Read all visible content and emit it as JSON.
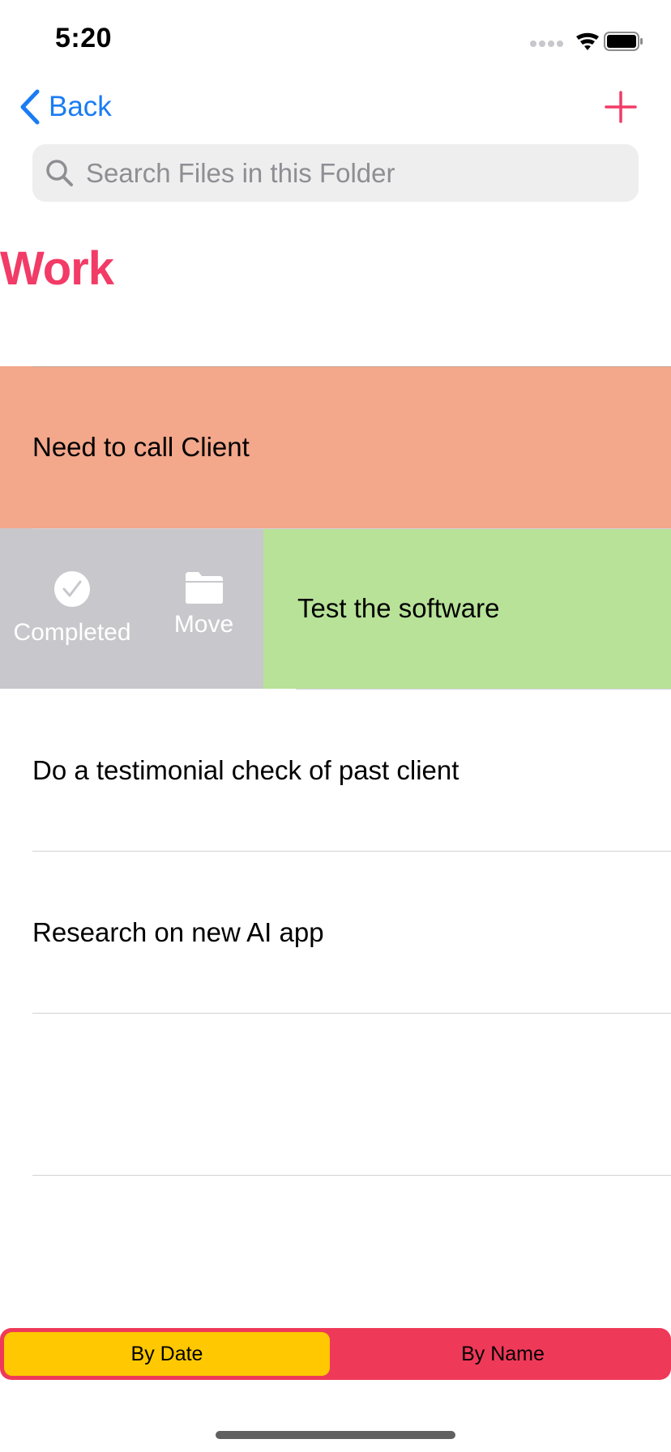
{
  "status_bar": {
    "time": "5:20"
  },
  "nav": {
    "back_label": "Back"
  },
  "search": {
    "placeholder": "Search Files in this Folder"
  },
  "page_title": "Work",
  "rows": [
    {
      "label": "Need to call Client",
      "color": "#f3a78b"
    },
    {
      "label": "Test the software",
      "color": "#b8e298"
    },
    {
      "label": "Do a testimonial check of past client",
      "color": "#ffffff"
    },
    {
      "label": "Research on new AI app",
      "color": "#ffffff"
    },
    {
      "label": "",
      "color": "#ffffff"
    }
  ],
  "swipe_actions": {
    "completed_label": "Completed",
    "move_label": "Move"
  },
  "sort_control": {
    "by_date_label": "By Date",
    "by_name_label": "By Name",
    "selected": "By Date"
  },
  "colors": {
    "accent_blue": "#1a7cf4",
    "title_pink": "#f23b66",
    "segment_bg": "#ef3959",
    "segment_selected": "#ffc800",
    "action_gray": "#c8c7cc"
  }
}
